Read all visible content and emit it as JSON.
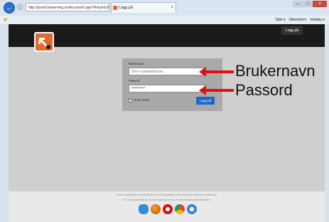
{
  "browser": {
    "address": "http://portal.itslearning.no/Account/Login?ReturnUrl=%2f",
    "tab_title": "Logg på",
    "tab_close": "×",
    "back_glyph": "←",
    "forward_glyph": "→",
    "favorites_glyph": "★",
    "window_controls": {
      "minimize": "–",
      "maximize": "□",
      "close": "×"
    },
    "command_bar": [
      "Side ▾",
      "Sikkerhet ▾",
      "Verktøy ▾"
    ]
  },
  "site": {
    "header_login_link": "Logg på",
    "login_form": {
      "username_label": "Brukernavn",
      "username_placeholder": "Din e-postadresse",
      "password_label": "Passord",
      "password_value": "••••••••",
      "remember_label": "Husk meg?",
      "submit_label": "Logg på"
    },
    "footer": {
      "line1": "Denne websiden er optimert for en av kompatibel med de fleste moderne nettlesere.",
      "line2": "For en opplevelse du få over sikre på ett av de videreutdannede tilskarne."
    },
    "browser_icon_names": [
      "internet-explorer-icon",
      "firefox-icon",
      "opera-icon",
      "chrome-icon",
      "safari-icon"
    ]
  },
  "annotations": {
    "username": "Brukernavn",
    "password": "Passord",
    "arrow_color": "#e01010"
  }
}
